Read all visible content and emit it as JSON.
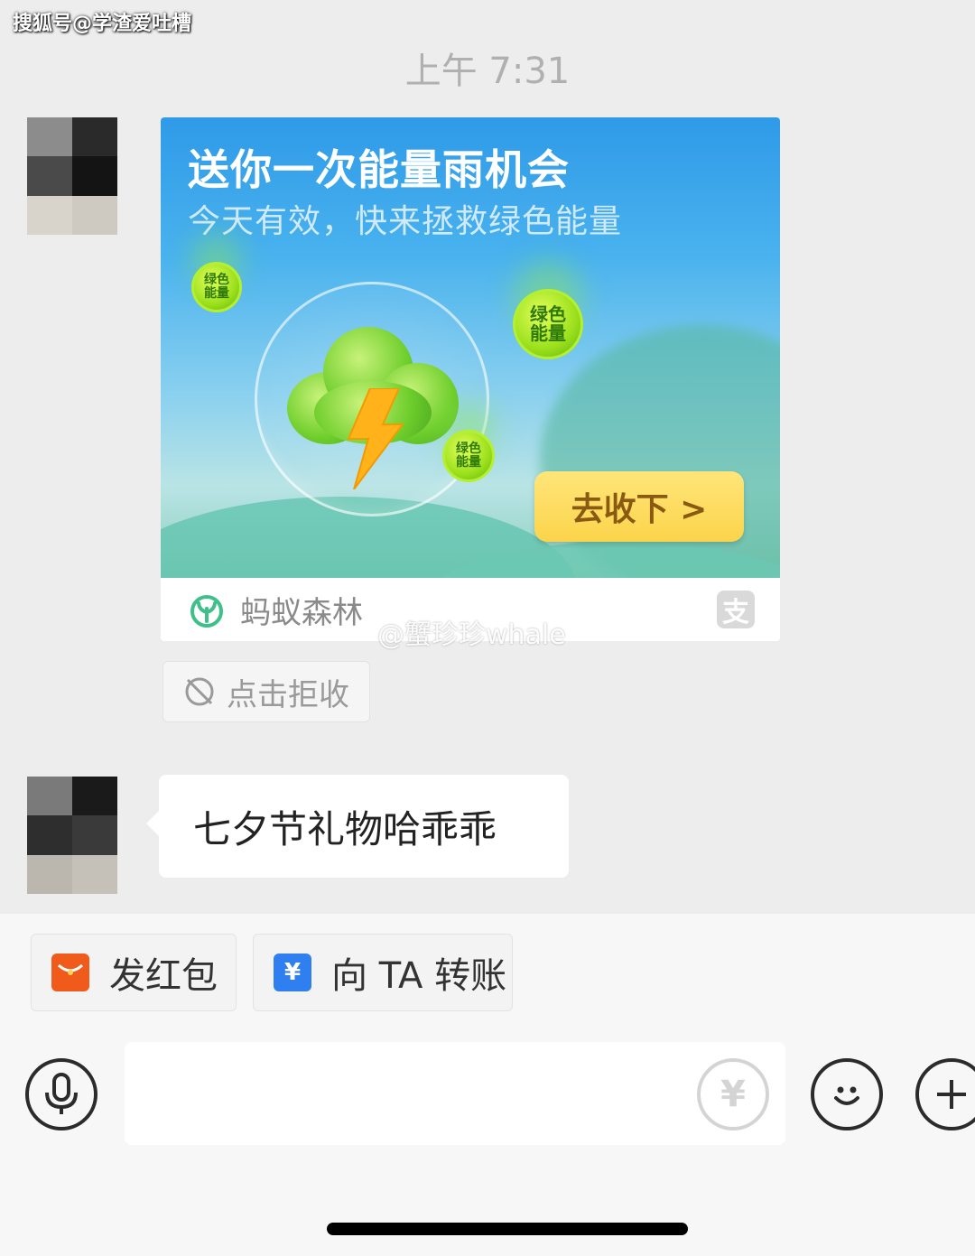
{
  "watermarks": {
    "source": "搜狐号@学渣爱吐槽",
    "weibo": "@蟹珍珍whale"
  },
  "timestamp": "上午 7:31",
  "card": {
    "title": "送你一次能量雨机会",
    "subtitle": "今天有效，快来拯救绿色能量",
    "energy_label": "绿色能量",
    "cta": "去收下 >",
    "app_name": "蚂蚁森林",
    "pay_logo": "支"
  },
  "reject": {
    "label": "点击拒收"
  },
  "message": {
    "text": "七夕节礼物哈乖乖"
  },
  "quick_actions": [
    {
      "label": "发红包",
      "icon": "red-packet-icon",
      "color": "#f05a1a"
    },
    {
      "label": "向 TA 转账",
      "icon": "transfer-icon",
      "color": "#2f7ff0"
    }
  ],
  "input": {
    "value": "",
    "placeholder": ""
  },
  "icons": {
    "voice": "microphone-icon",
    "money": "yuan-icon",
    "emoji": "smiley-icon",
    "more": "plus-icon"
  },
  "colors": {
    "background": "#ededed",
    "banner_blue": "#2f9ae8",
    "cta_yellow": "#fbd44a",
    "energy_green": "#9be01c",
    "forest_green": "#3fbf8a"
  }
}
